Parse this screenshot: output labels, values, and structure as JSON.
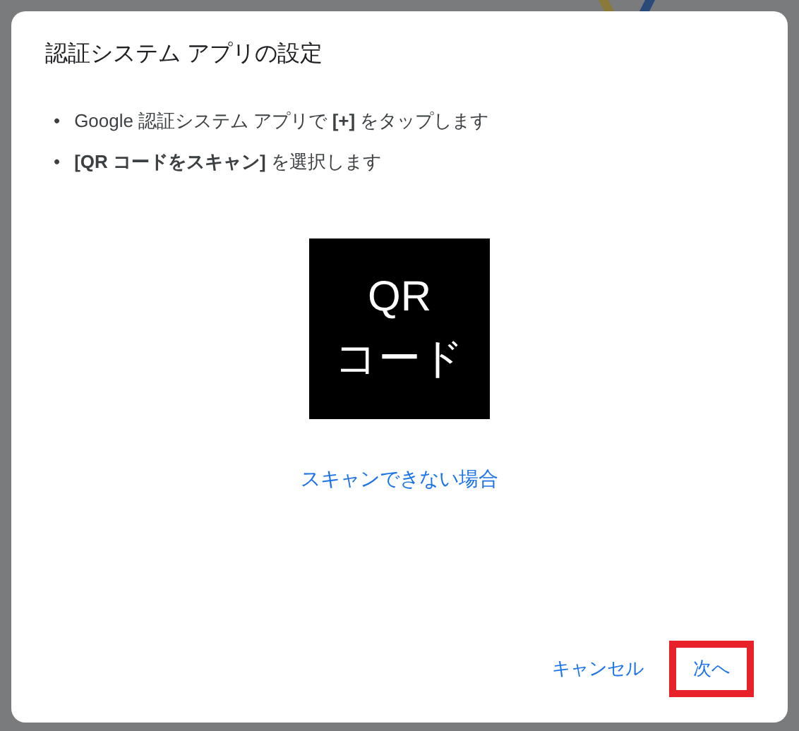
{
  "dialog": {
    "title": "認証システム アプリの設定",
    "steps": [
      {
        "bullet": "•",
        "text": "Google 認証システム アプリで **[+]** をタップします"
      },
      {
        "bullet": "•",
        "text": "**[QR コードをスキャン]** を選択します"
      }
    ],
    "qr_placeholder": {
      "lines": [
        "QR",
        "コード"
      ]
    },
    "link": "スキャンできない場合",
    "buttons": [
      {
        "label": "キャンセル",
        "highlighted": false
      },
      {
        "label": "次へ",
        "highlighted": true
      }
    ]
  }
}
